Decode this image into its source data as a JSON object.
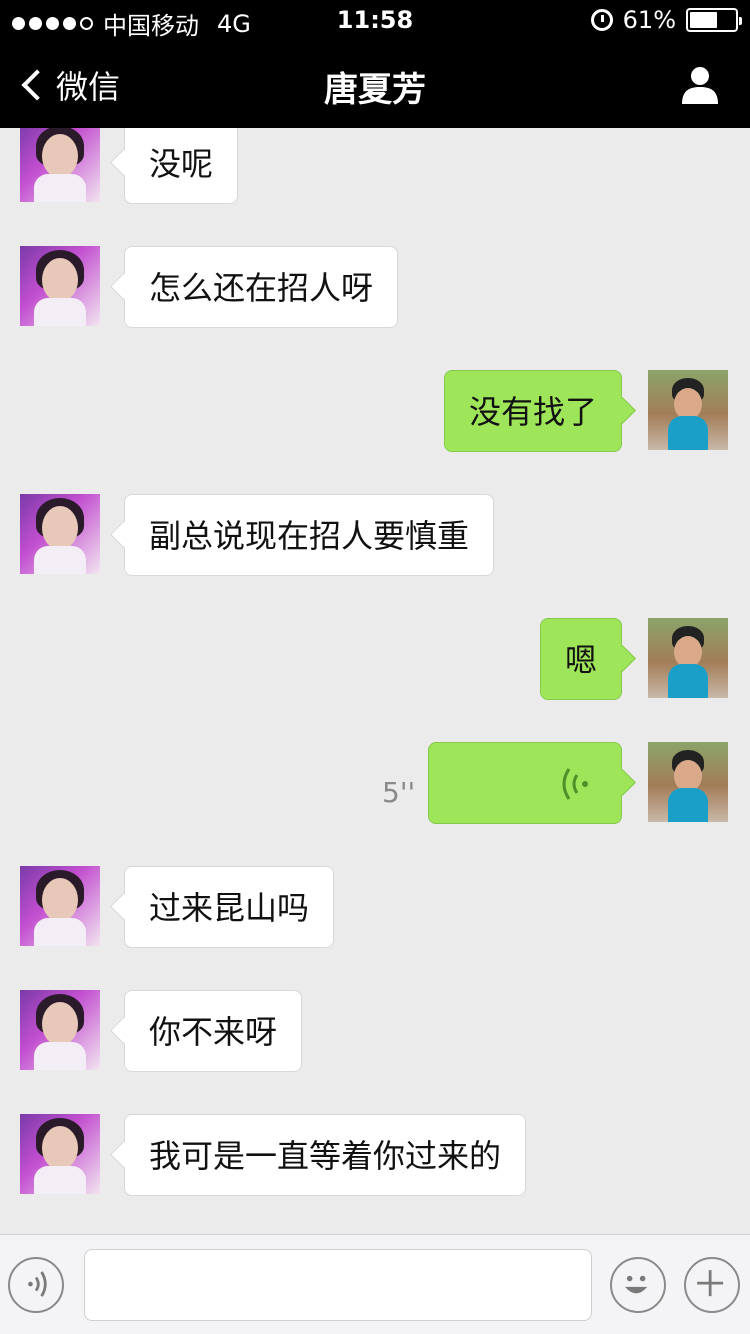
{
  "status_bar": {
    "carrier": "中国移动",
    "network": "4G",
    "time": "11:58",
    "battery": "61%",
    "battery_level": 0.61,
    "signal_bars": 4,
    "icons": [
      "signal-dots-icon",
      "alarm-icon",
      "battery-icon"
    ]
  },
  "nav": {
    "back_label": "微信",
    "title": "唐夏芳",
    "icons": [
      "chevron-left-icon",
      "person-icon"
    ]
  },
  "messages": [
    {
      "from": "them",
      "type": "text",
      "text": "没呢"
    },
    {
      "from": "them",
      "type": "text",
      "text": "怎么还在招人呀"
    },
    {
      "from": "me",
      "type": "text",
      "text": "没有找了"
    },
    {
      "from": "them",
      "type": "text",
      "text": "副总说现在招人要慎重"
    },
    {
      "from": "me",
      "type": "text",
      "text": "嗯"
    },
    {
      "from": "me",
      "type": "voice",
      "duration": "5''"
    },
    {
      "from": "them",
      "type": "text",
      "text": "过来昆山吗"
    },
    {
      "from": "them",
      "type": "text",
      "text": "你不来呀"
    },
    {
      "from": "them",
      "type": "text",
      "text": "我可是一直等着你过来的"
    }
  ],
  "input_bar": {
    "placeholder": "",
    "value": "",
    "icons": [
      "voice-input-icon",
      "emoji-icon",
      "plus-icon"
    ]
  },
  "colors": {
    "navbar_bg": "#000000",
    "chat_bg": "#ebebeb",
    "outgoing_bubble": "#9fe55a",
    "incoming_bubble": "#ffffff"
  }
}
